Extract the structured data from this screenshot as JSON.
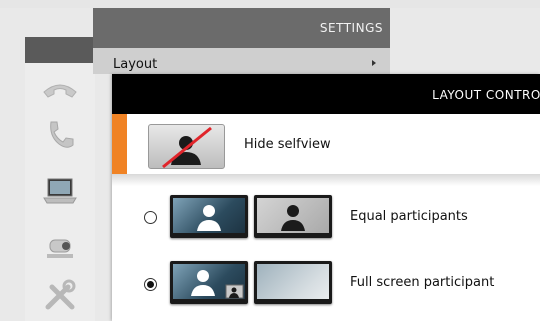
{
  "settings": {
    "title": "SETTINGS",
    "layout_item": "Layout"
  },
  "layout_control": {
    "title": "LAYOUT CONTROL",
    "hide_selfview_label": "Hide selfview",
    "options": [
      {
        "label": "Equal participants",
        "selected": false
      },
      {
        "label": "Full screen participant",
        "selected": true
      }
    ]
  },
  "rail": {
    "icons": [
      "end-call-icon",
      "phone-icon",
      "laptop-icon",
      "camera-icon",
      "tools-icon"
    ]
  },
  "colors": {
    "accent": "#f08325",
    "header_black": "#000000",
    "settings_header": "#6b6b6b"
  }
}
